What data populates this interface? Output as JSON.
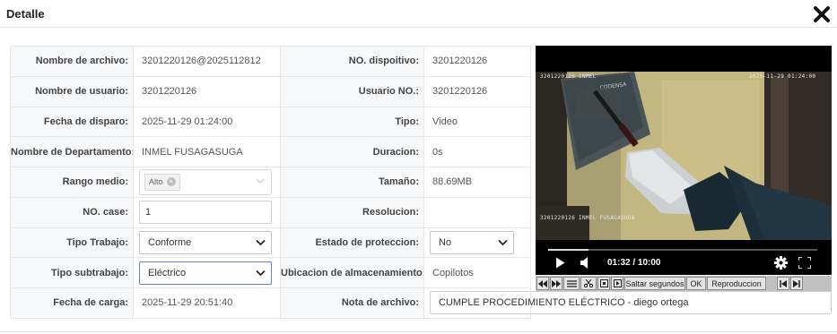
{
  "dialog": {
    "title": "Detalle",
    "close_icon": "close-icon"
  },
  "labels": {
    "file_name": "Nombre de archivo:",
    "device_no": "NO. dispoitivo:",
    "user_name": "Nombre de usuario:",
    "user_no": "Usuario NO.:",
    "trigger_date": "Fecha de disparo:",
    "type": "Tipo:",
    "department": "Nombre de Departamento:",
    "duration": "Duracion:",
    "range": "Rango medio:",
    "size": "Tamaño:",
    "case_no": "NO. case:",
    "resolution": "Resolucion:",
    "work_type": "Tipo Trabajo:",
    "protection": "Estado de proteccion:",
    "work_subtype": "Tipo subtrabajo:",
    "storage": "Ubicacion de almacenamiento:",
    "upload_date": "Fecha de carga:",
    "file_note": "Nota de archivo:"
  },
  "values": {
    "file_name": "3201220126@2025112812",
    "device_no": "3201220126",
    "user_name": "3201220126",
    "user_no": "3201220126",
    "trigger_date": "2025-11-29 01:24:00",
    "type": "Video",
    "department": "INMEL FUSAGASUGA",
    "duration": "0s",
    "range_tag": "Alto",
    "size": "88.69MB",
    "case_no": "1",
    "resolution": "",
    "work_type": "Conforme",
    "protection": "No",
    "work_subtype": "Eléctrico",
    "storage": "Copilotos",
    "upload_date": "2025-11-29 20:51:40",
    "file_note": "CUMPLE PROCEDIMIENTO ELÉCTRICO - diego ortega"
  },
  "player": {
    "time": "01:32 / 10:00",
    "progress": 0.15,
    "osd_top_left": "3201220126 INMEL",
    "osd_top_right": "2025-11-29 01:24:00",
    "osd_bottom_left": "3201220126 INMEL FUSAGASUGA",
    "box_text": "CODENSA"
  },
  "toolbar": {
    "skip_placeholder": "Saltar segundos",
    "ok": "OK",
    "playback": "Reproduccion"
  },
  "colors": {
    "label_bg": "#f7f8fa",
    "border": "#e4e6ea",
    "focus": "#6a7fd0"
  }
}
